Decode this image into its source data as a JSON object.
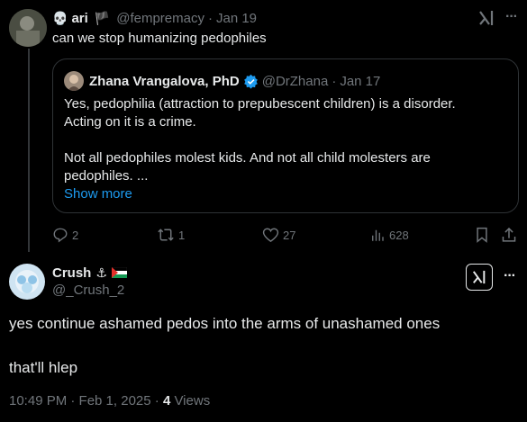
{
  "tweet": {
    "display_name": "ari",
    "handle": "@fempremacy",
    "date": "Jan 19",
    "text": "can we stop humanizing pedophiles"
  },
  "quote": {
    "display_name": "Zhana Vrangalova, PhD",
    "handle": "@DrZhana",
    "date": "Jan 17",
    "line1": "Yes, pedophilia (attraction to prepubescent children) is a disorder.",
    "line2": "Acting on it is a crime.",
    "line3": "Not all pedophiles molest kids. And not all child molesters are",
    "line4": "pedophiles. ...",
    "show_more": "Show more"
  },
  "actions": {
    "replies": "2",
    "retweets": "1",
    "likes": "27",
    "views": "628"
  },
  "reply": {
    "display_name": "Crush",
    "handle": "@_Crush_2",
    "line1": "yes continue ashamed pedos into the arms of unashamed ones",
    "line2": "that'll hlep",
    "timestamp": "10:49 PM · Feb 1, 2025 · ",
    "views_count": "4",
    "views_label": " Views"
  },
  "more_label": "···",
  "colors": {
    "accent": "#1d9bf0",
    "muted": "#71767b",
    "border": "#2f3336",
    "verified": "#1d9bf0"
  }
}
